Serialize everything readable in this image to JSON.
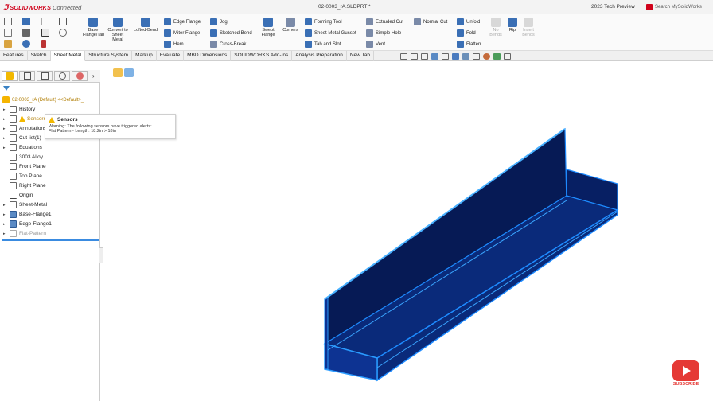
{
  "titlebar": {
    "app_name": "SOLIDWORKS",
    "app_suffix": "Connected",
    "document_title": "02-0003_rA.SLDPRT *",
    "preview_label": "2023 Tech Preview",
    "search_label": "Search MySolidWorks"
  },
  "ribbon": {
    "large": [
      {
        "label": "Base Flange/Tab"
      },
      {
        "label": "Convert to Sheet Metal"
      },
      {
        "label": "Lofted-Bend"
      },
      {
        "label": "Swept Flange"
      },
      {
        "label": "Corners"
      },
      {
        "label": "Rip"
      },
      {
        "label": "Insert Bends"
      },
      {
        "label": "No Bends"
      }
    ],
    "small": [
      {
        "label": "Edge Flange"
      },
      {
        "label": "Miter Flange"
      },
      {
        "label": "Hem"
      },
      {
        "label": "Jog"
      },
      {
        "label": "Sketched Bend"
      },
      {
        "label": "Cross-Break"
      },
      {
        "label": "Forming Tool"
      },
      {
        "label": "Sheet Metal Gusset"
      },
      {
        "label": "Tab and Slot"
      },
      {
        "label": "Extruded Cut"
      },
      {
        "label": "Simple Hole"
      },
      {
        "label": "Vent"
      },
      {
        "label": "Normal Cut"
      },
      {
        "label": "Unfold"
      },
      {
        "label": "Fold"
      },
      {
        "label": "Flatten"
      }
    ]
  },
  "tabs": [
    {
      "label": "Features"
    },
    {
      "label": "Sketch"
    },
    {
      "label": "Sheet Metal"
    },
    {
      "label": "Structure System"
    },
    {
      "label": "Markup"
    },
    {
      "label": "Evaluate"
    },
    {
      "label": "MBD Dimensions"
    },
    {
      "label": "SOLIDWORKS Add-Ins"
    },
    {
      "label": "Analysis Preparation"
    },
    {
      "label": "New Tab"
    }
  ],
  "tree": {
    "root": "02-0003_rA (Default) <<Default>_",
    "items": [
      {
        "label": "History"
      },
      {
        "label": "Sensors"
      },
      {
        "label": "Annotations"
      },
      {
        "label": "Cut list(1)"
      },
      {
        "label": "Equations"
      },
      {
        "label": "3003 Alloy"
      },
      {
        "label": "Front Plane"
      },
      {
        "label": "Top Plane"
      },
      {
        "label": "Right Plane"
      },
      {
        "label": "Origin"
      },
      {
        "label": "Sheet-Metal"
      },
      {
        "label": "Base-Flange1"
      },
      {
        "label": "Edge-Flange1"
      },
      {
        "label": "Flat-Pattern"
      }
    ]
  },
  "tooltip": {
    "title": "Sensors",
    "line1": "Warning: The following sensors have triggered alerts:",
    "line2": "Flat Pattern - Length: 18.2in > 18in"
  },
  "overlay": {
    "subscribe": "SUBSCRIBE"
  }
}
